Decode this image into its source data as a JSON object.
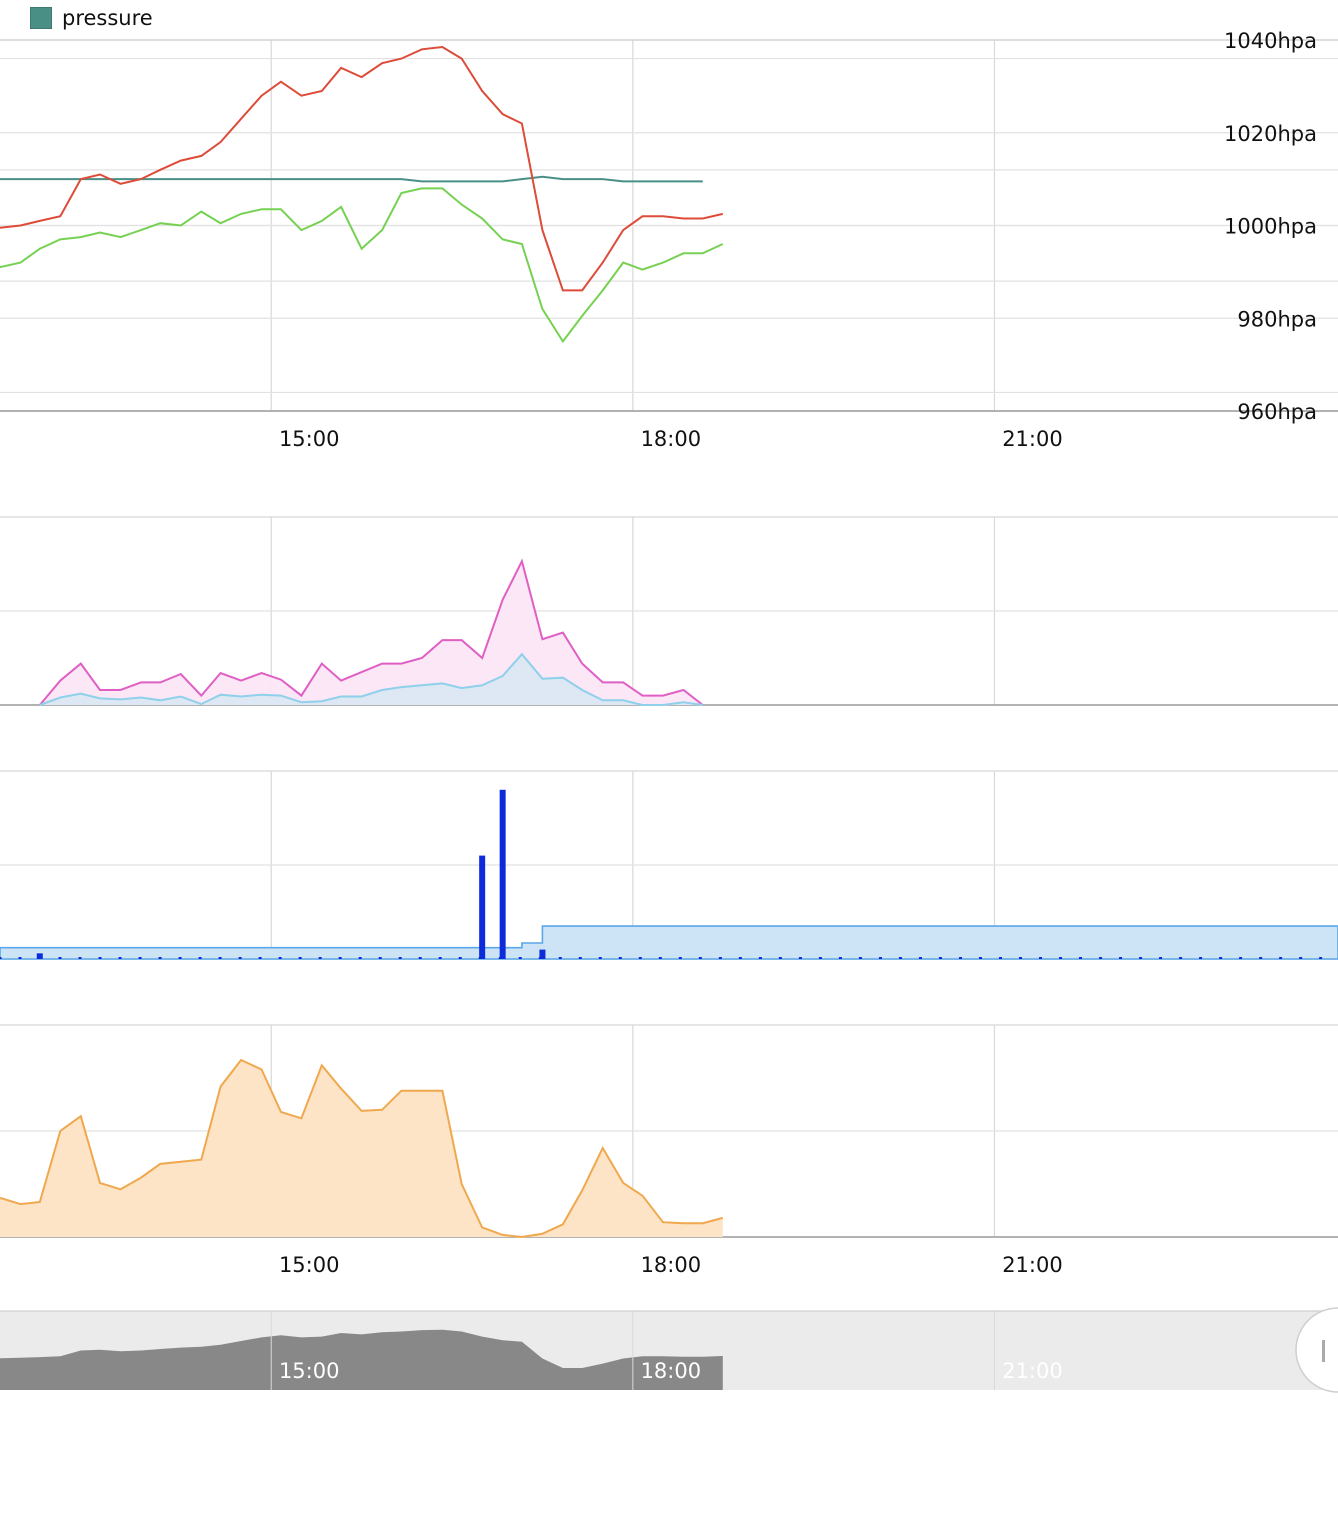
{
  "legend": {
    "label": "pressure",
    "color": "#4a8f86"
  },
  "chart_data": [
    {
      "type": "line",
      "y_unit": "hpa",
      "y_tick_labels": [
        "1040hpa",
        "1020hpa",
        "1000hpa",
        "980hpa",
        "960hpa"
      ],
      "y_ticks": [
        1040,
        1020,
        1000,
        980,
        960
      ],
      "ylim": [
        960,
        1040
      ],
      "x_tick_labels": [
        "15:00",
        "18:00",
        "21:00"
      ],
      "x_ticks_hours": [
        15,
        18,
        21
      ],
      "xlim_hours": [
        12.75,
        23.85
      ],
      "x_hours": [
        12.75,
        12.92,
        13.08,
        13.25,
        13.42,
        13.58,
        13.75,
        13.92,
        14.08,
        14.25,
        14.42,
        14.58,
        14.75,
        14.92,
        15.08,
        15.25,
        15.42,
        15.58,
        15.75,
        15.92,
        16.08,
        16.25,
        16.42,
        16.58,
        16.75,
        16.92,
        17.08,
        17.25,
        17.42,
        17.58,
        17.75,
        17.92,
        18.08,
        18.25,
        18.42,
        18.58
      ],
      "series": [
        {
          "name": "pressure",
          "color": "#4a8f86",
          "values": [
            1010,
            1010,
            1010,
            1010,
            1010,
            1010,
            1010,
            1010,
            1010,
            1010,
            1010,
            1010,
            1010,
            1010,
            1010,
            1010,
            1010,
            1010,
            1010,
            1010,
            1010,
            1009.5,
            1009.5,
            1009.5,
            1009.5,
            1009.5,
            1010,
            1010.5,
            1010,
            1010,
            1010,
            1009.5,
            1009.5,
            1009.5,
            1009.5,
            1009.5
          ]
        },
        {
          "name": "",
          "color": "#dd4b39",
          "values": [
            999.5,
            1000,
            1001,
            1002,
            1010,
            1011,
            1009,
            1010,
            1012,
            1014,
            1015,
            1018,
            1023,
            1028,
            1031,
            1028,
            1029,
            1034,
            1032,
            1035,
            1036,
            1038,
            1038.5,
            1036,
            1029,
            1024,
            1022,
            999,
            986,
            986,
            992,
            999,
            1002,
            1002,
            1001.5,
            1001.5,
            1002.5
          ]
        },
        {
          "name": "",
          "color": "#76d152",
          "values": [
            991,
            992,
            995,
            997,
            997.5,
            998.5,
            997.5,
            999,
            1000.5,
            1000,
            1003,
            1000.5,
            1002.5,
            1003.5,
            1003.5,
            999,
            1001,
            1004,
            995,
            999,
            1007,
            1008,
            1008,
            1004.5,
            1001.5,
            997,
            996,
            982,
            975,
            980.5,
            986,
            992,
            990.5,
            992,
            994,
            994,
            996
          ]
        }
      ]
    },
    {
      "type": "area",
      "x_hours": [
        13.08,
        13.25,
        13.42,
        13.58,
        13.75,
        13.92,
        14.08,
        14.25,
        14.42,
        14.58,
        14.75,
        14.92,
        15.08,
        15.25,
        15.42,
        15.58,
        15.75,
        15.92,
        16.08,
        16.25,
        16.42,
        16.58,
        16.75,
        16.92,
        17.08,
        17.25,
        17.42,
        17.58,
        17.75,
        17.92,
        18.08,
        18.25,
        18.42,
        18.58
      ],
      "ylim": [
        0,
        20
      ],
      "series": [
        {
          "name": "",
          "color": "#e05fc4",
          "fill": "#fbe6f6",
          "values": [
            0,
            2.6,
            4.4,
            1.6,
            1.6,
            2.4,
            2.4,
            3.3,
            1,
            3.4,
            2.6,
            3.4,
            2.7,
            1,
            4.4,
            2.6,
            3.5,
            4.4,
            4.4,
            5,
            6.9,
            6.9,
            5,
            11.2,
            15.3,
            7,
            7.7,
            4.4,
            2.4,
            2.4,
            1,
            1,
            1.6,
            0
          ]
        },
        {
          "name": "",
          "color": "#8fd0ea",
          "fill": "#dbe8f3",
          "values": [
            0,
            0.8,
            1.2,
            0.7,
            0.6,
            0.8,
            0.5,
            0.9,
            0.1,
            1.1,
            0.9,
            1.1,
            1,
            0.3,
            0.4,
            0.9,
            0.9,
            1.6,
            1.9,
            2.1,
            2.3,
            1.8,
            2.1,
            3.1,
            5.4,
            2.8,
            2.9,
            1.6,
            0.5,
            0.5,
            0,
            0,
            0.3,
            0
          ]
        }
      ]
    },
    {
      "type": "bar",
      "ylim": [
        0,
        20
      ],
      "x_hours": [
        13.08,
        16.75,
        16.92,
        17.08,
        17.25
      ],
      "values": [
        0.6,
        11,
        18,
        0,
        1
      ],
      "bar_color": "#0c2bd9",
      "step_color": "#5aa7ea",
      "step_fill": "#cde4f7",
      "step_segments": [
        {
          "from": 12.75,
          "to": 17.08,
          "value": 1.2
        },
        {
          "from": 17.08,
          "to": 17.25,
          "value": 1.7
        },
        {
          "from": 17.25,
          "to": 23.85,
          "value": 3.5
        }
      ]
    },
    {
      "type": "area",
      "x_hours": [
        12.75,
        12.92,
        13.08,
        13.25,
        13.42,
        13.58,
        13.75,
        13.92,
        14.08,
        14.25,
        14.42,
        14.58,
        14.75,
        14.92,
        15.08,
        15.25,
        15.42,
        15.58,
        15.75,
        15.92,
        16.08,
        16.25,
        16.42,
        16.58,
        16.75,
        16.92,
        17.08,
        17.25,
        17.42,
        17.58,
        17.75,
        17.92,
        18.08,
        18.25,
        18.42,
        18.58
      ],
      "ylim": [
        0,
        20
      ],
      "series": [
        {
          "name": "",
          "color": "#f0a84e",
          "fill": "#fde4c6",
          "values": [
            3.7,
            3.1,
            3.3,
            10,
            11.4,
            5.1,
            4.5,
            5.6,
            6.9,
            7.1,
            7.3,
            14.2,
            16.7,
            15.8,
            11.8,
            11.2,
            16.2,
            14,
            11.9,
            12,
            13.8,
            13.8,
            13.8,
            5,
            0.9,
            0.2,
            0,
            0.3,
            1.2,
            4.4,
            8.4,
            5.1,
            3.9,
            1.4,
            1.3,
            1.3,
            1.8
          ]
        }
      ]
    }
  ],
  "navigator": {
    "x_tick_labels": [
      "15:00",
      "18:00",
      "21:00"
    ],
    "fill": "#888888",
    "background": "#ebebeb"
  }
}
